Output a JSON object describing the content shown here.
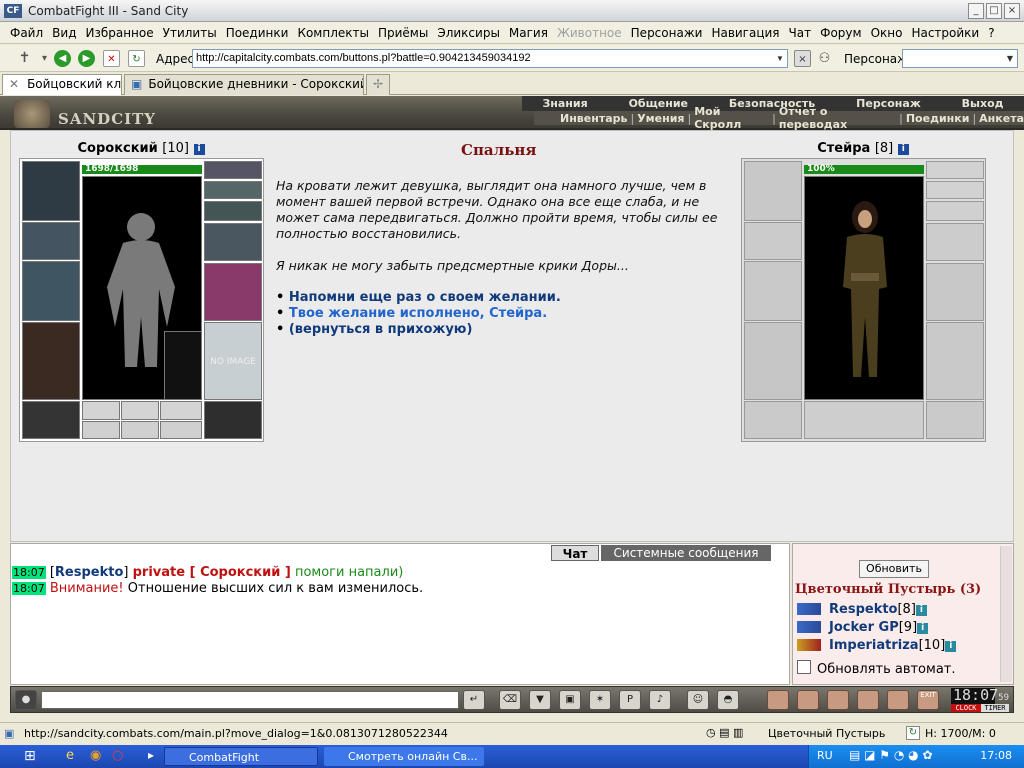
{
  "window": {
    "title": "CombatFight III - Sand City",
    "logo": "CF"
  },
  "menu": [
    "Файл",
    "Вид",
    "Избранное",
    "Утилиты",
    "Поединки",
    "Комплекты",
    "Приёмы",
    "Эликсиры",
    "Магия",
    "Животное",
    "Персонажи",
    "Навигация",
    "Чат",
    "Форум",
    "Окно",
    "Настройки",
    "?"
  ],
  "menu_disabled": "Животное",
  "address": {
    "label": "Адрес:",
    "value": "http://capitalcity.combats.com/buttons.pl?battle=0.904213459034192",
    "char_label": "Персонаж:"
  },
  "tabs": [
    {
      "label": "Бойцовский клуб"
    },
    {
      "label": "Бойцовские дневники - Сорокский -..."
    }
  ],
  "header": {
    "logo": "SANDCITY",
    "nav1": [
      "Знания",
      "Общение",
      "Безопасность",
      "Персонаж",
      "Выход"
    ],
    "nav2": [
      "Инвентарь",
      "Умения",
      "Мой Скролл",
      "Отчет о переводах",
      "Поединки",
      "Анкета"
    ]
  },
  "player": {
    "name": "Сорокский",
    "level": "[10]",
    "hp": "1698/1698",
    "no_image": "NO IMAGE"
  },
  "npc": {
    "name": "Стейра",
    "level": "[8]",
    "hp": "100%"
  },
  "room": {
    "title": "Спальня",
    "p1": "На кровати лежит девушка, выглядит она намного лучше, чем в момент вашей первой встречи. Однако она все еще слаба, и не может сама передвигаться. Должно пройти время, чтобы силы ее полностью восстановились.",
    "p2": "Я никак не могу забыть предсмертные крики Доры...",
    "options": [
      {
        "text": "Напомни еще раз о своем желании.",
        "color": "#113a7a"
      },
      {
        "text": "Твое желание исполнено, Стейра.",
        "color": "#2266cc"
      },
      {
        "text": "(вернуться в прихожую)",
        "color": "#113a7a"
      }
    ]
  },
  "chat": {
    "tab_chat": "Чат",
    "tab_system": "Системные сообщения",
    "messages": [
      {
        "time": "18:07",
        "sender": "Respekto",
        "private": "private [ Сорокский ]",
        "text": "помоги напали)"
      },
      {
        "time": "18:07",
        "warn": "Внимание!",
        "text": "Отношение высших сил к вам изменилось."
      }
    ]
  },
  "users": {
    "refresh": "Обновить",
    "location": "Цветочный Пустырь (3)",
    "list": [
      {
        "name": "Respekto",
        "level": "[8]"
      },
      {
        "name": "Jocker GP",
        "level": "[9]"
      },
      {
        "name": "Imperiatriza",
        "level": "[10]"
      }
    ],
    "auto": "Обновлять автомат."
  },
  "toolbar": {
    "clock": "18:07",
    "seconds": "59",
    "clock_label": "CLOCK",
    "timer_label": "TIMER",
    "exit": "EXIT"
  },
  "status": {
    "url": "http://sandcity.combats.com/main.pl?move_dialog=1&0.0813071280522344",
    "location": "Цветочный Пустырь",
    "hp": "H: 1700/M: 0"
  },
  "taskbar": {
    "task1": "CombatFight",
    "task2": "Смотреть онлайн Св...",
    "lang": "RU",
    "time": "17:08"
  },
  "colors": {
    "accent": "#7a1010",
    "hp_bar": "#178a17",
    "time_bg": "#00e37a"
  }
}
